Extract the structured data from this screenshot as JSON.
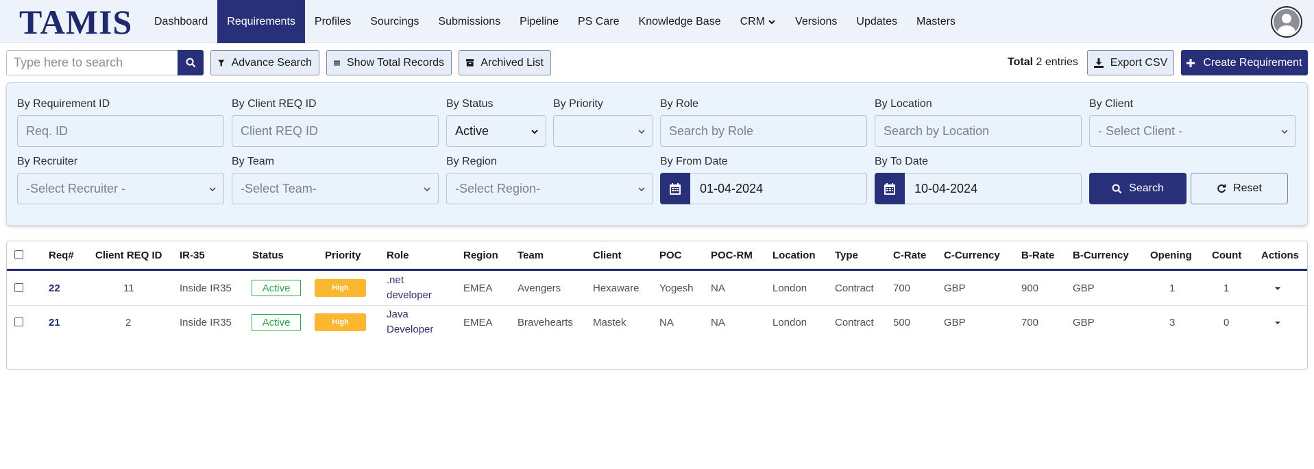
{
  "app": {
    "logo": "TAMIS"
  },
  "nav": {
    "items": [
      "Dashboard",
      "Requirements",
      "Profiles",
      "Sourcings",
      "Submissions",
      "Pipeline",
      "PS Care",
      "Knowledge Base",
      "CRM",
      "Versions",
      "Updates",
      "Masters"
    ],
    "active": "Requirements"
  },
  "toolbar": {
    "search_placeholder": "Type here to search",
    "advance_search": "Advance Search",
    "show_total": "Show Total Records",
    "archived": "Archived List",
    "total_label": "Total",
    "total_value": "2 entries",
    "export": "Export CSV",
    "create": "Create Requirement"
  },
  "filters": {
    "req_id": {
      "label": "By Requirement ID",
      "placeholder": "Req. ID"
    },
    "client_req": {
      "label": "By Client REQ ID",
      "placeholder": "Client REQ ID"
    },
    "status": {
      "label": "By Status",
      "value": "Active"
    },
    "priority": {
      "label": "By Priority",
      "value": ""
    },
    "role": {
      "label": "By Role",
      "placeholder": "Search by Role"
    },
    "location": {
      "label": "By Location",
      "placeholder": "Search by Location"
    },
    "client": {
      "label": "By Client",
      "value": "- Select Client -"
    },
    "recruiter": {
      "label": "By Recruiter",
      "value": "-Select Recruiter -"
    },
    "team": {
      "label": "By Team",
      "value": "-Select Team-"
    },
    "region": {
      "label": "By Region",
      "value": "-Select Region-"
    },
    "from_date": {
      "label": "By From Date",
      "value": "01-04-2024"
    },
    "to_date": {
      "label": "By To Date",
      "value": "10-04-2024"
    },
    "search_btn": "Search",
    "reset_btn": "Reset"
  },
  "table": {
    "headers": [
      "Req#",
      "Client REQ ID",
      "IR-35",
      "Status",
      "Priority",
      "Role",
      "Region",
      "Team",
      "Client",
      "POC",
      "POC-RM",
      "Location",
      "Type",
      "C-Rate",
      "C-Currency",
      "B-Rate",
      "B-Currency",
      "Opening",
      "Count",
      "Actions"
    ],
    "rows": [
      {
        "req": "22",
        "client_req": "11",
        "ir35": "Inside IR35",
        "status": "Active",
        "priority": "High",
        "role_1": ".net",
        "role_2": "developer",
        "region": "EMEA",
        "team": "Avengers",
        "client": "Hexaware",
        "poc": "Yogesh",
        "poc_rm": "NA",
        "location": "London",
        "type": "Contract",
        "c_rate": "700",
        "c_currency": "GBP",
        "b_rate": "900",
        "b_currency": "GBP",
        "opening": "1",
        "count": "1"
      },
      {
        "req": "21",
        "client_req": "2",
        "ir35": "Inside IR35",
        "status": "Active",
        "priority": "High",
        "role_1": "Java",
        "role_2": "Developer",
        "region": "EMEA",
        "team": "Bravehearts",
        "client": "Mastek",
        "poc": "NA",
        "poc_rm": "NA",
        "location": "London",
        "type": "Contract",
        "c_rate": "500",
        "c_currency": "GBP",
        "b_rate": "700",
        "b_currency": "GBP",
        "opening": "3",
        "count": "0"
      }
    ]
  },
  "colors": {
    "primary": "#28307a",
    "active_status": "#28a745",
    "priority_high": "#fbb730"
  }
}
